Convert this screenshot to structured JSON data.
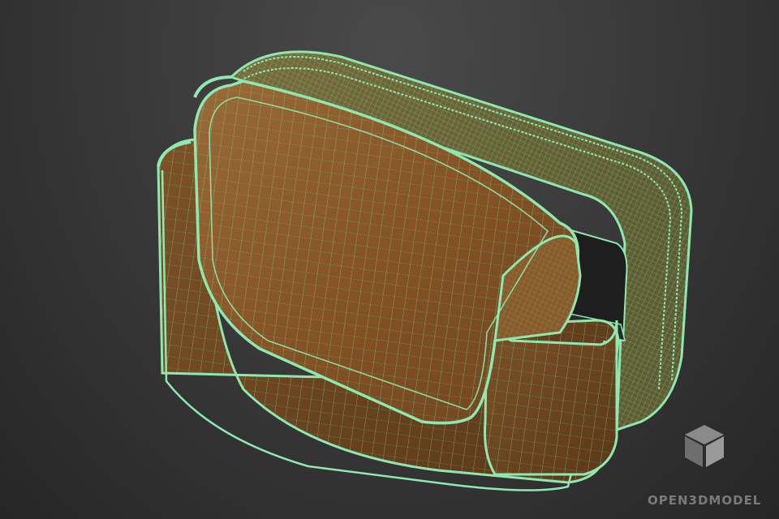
{
  "scene": {
    "description_kind": "3d-wireframe-render",
    "object": "phone-pouch",
    "colors": {
      "background_top": "#4a4a4a",
      "background_bottom": "#262626",
      "body_fill": "#8a5a2a",
      "body_fill_dark": "#5e3a1a",
      "wire": "#6fe0a0",
      "edge": "#8fe8b0",
      "pocket_inner": "#1e1e1e"
    }
  },
  "watermark": {
    "text": "OPEN3DMODEL",
    "icon": "cube-icon",
    "color": "#7a7a7a"
  }
}
